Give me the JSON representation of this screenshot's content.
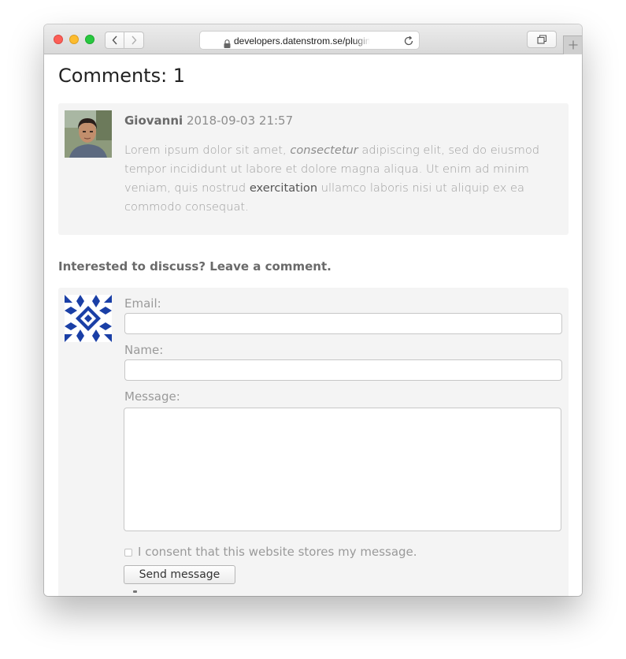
{
  "browser": {
    "url": "developers.datenstrom.se/plugins/b",
    "icons": {
      "back": "chevron-left-icon",
      "forward": "chevron-right-icon",
      "secure": "lock-icon",
      "reload": "reload-icon",
      "tabs": "tabs-overview-icon",
      "new_tab": "plus-icon"
    }
  },
  "page": {
    "comments_heading": "Comments: 1",
    "comments": [
      {
        "author": "Giovanni",
        "date": "2018-09-03 21:57",
        "text_before_italic": "Lorem ipsum dolor sit amet, ",
        "text_italic": "consectetur",
        "text_middle": " adipiscing elit, sed do eiusmod tempor incididunt ut labore et dolore magna aliqua. Ut enim ad minim veniam, quis nostrud ",
        "text_bold": "exercitation",
        "text_after": " ullamco laboris nisi ut aliquip ex ea commodo consequat.",
        "avatar": "author-photo"
      }
    ],
    "form": {
      "intro": "Interested to discuss? Leave a comment.",
      "email_label": "Email:",
      "email_value": "",
      "name_label": "Name:",
      "name_value": "",
      "message_label": "Message:",
      "message_value": "",
      "consent_label": "I consent that this website stores my message.",
      "consent_checked": false,
      "submit_label": "Send message",
      "avatar": "identicon-pattern",
      "identicon_color": "#1a3fa6"
    }
  },
  "colors": {
    "traffic_close": "#fc5f57",
    "traffic_minimize": "#fdbc2e",
    "traffic_zoom": "#28c840",
    "panel_bg": "#f4f4f4"
  }
}
